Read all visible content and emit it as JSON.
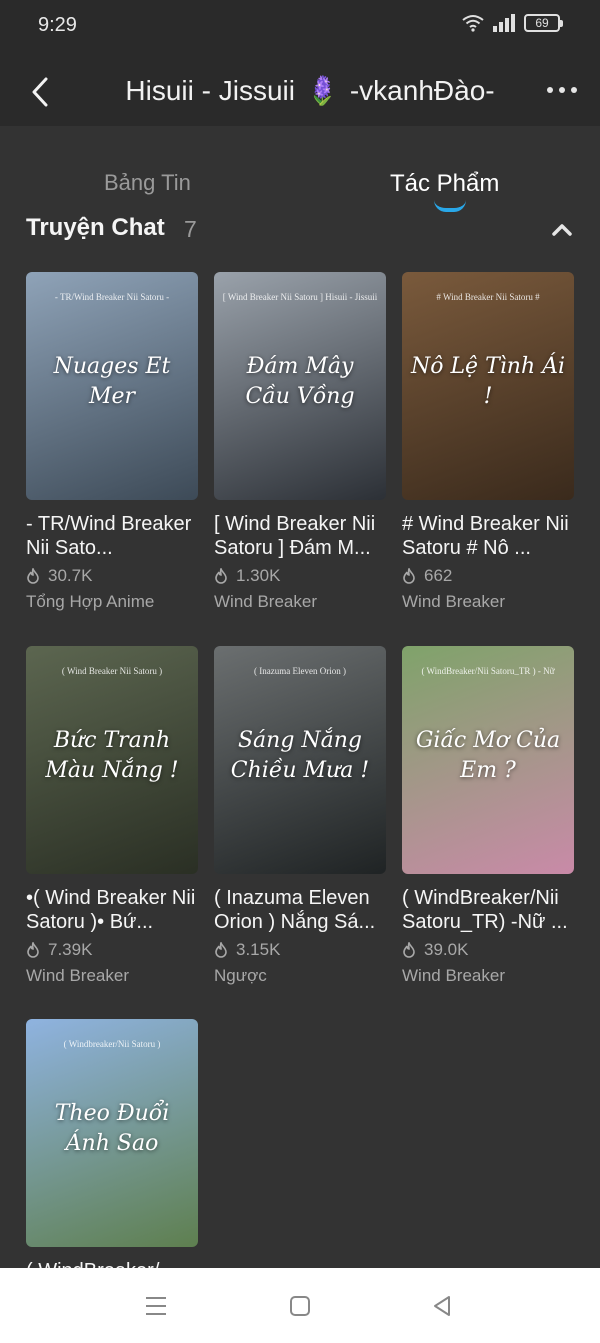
{
  "status": {
    "time": "9:29",
    "battery": "69"
  },
  "header": {
    "title": "Hisuii - Jissuii",
    "title_suffix": "-vkanhĐào-",
    "flower_emoji": "🪻"
  },
  "tabs": [
    {
      "label": "Bảng Tin"
    },
    {
      "label": "Tác Phẩm"
    }
  ],
  "section": {
    "title": "Truyện Chat",
    "count": "7"
  },
  "stories": [
    {
      "title": "- TR/Wind Breaker Nii Sato...",
      "reads": "30.7K",
      "genre": "Tổng Hợp Anime",
      "cover_tag": "- TR/Wind Breaker Nii Satoru -",
      "cover_text": "Nuages Et Mer",
      "cover_colors": [
        "#8fa3b8",
        "#3d4a57"
      ]
    },
    {
      "title": "[ Wind Breaker Nii Satoru ] Đám M...",
      "reads": "1.30K",
      "genre": "Wind Breaker",
      "cover_tag": "[ Wind Breaker Nii Satoru ] Hisuii - Jissuii",
      "cover_text": "Đám Mây Cầu Vồng",
      "cover_colors": [
        "#9aa2ab",
        "#2c3036"
      ]
    },
    {
      "title": "# Wind Breaker Nii Satoru # Nô ...",
      "reads": "662",
      "genre": "Wind Breaker",
      "cover_tag": "# Wind Breaker Nii Satoru #",
      "cover_text": "Nô Lệ Tình Ái !",
      "cover_colors": [
        "#7a5a3c",
        "#3a2a1c"
      ]
    },
    {
      "title": "•( Wind Breaker Nii Satoru )• Bứ...",
      "reads": "7.39K",
      "genre": "Wind Breaker",
      "cover_tag": "( Wind Breaker Nii Satoru )",
      "cover_text": "Bức Tranh Màu Nắng !",
      "cover_colors": [
        "#5c6650",
        "#2a2f24"
      ]
    },
    {
      "title": "( Inazuma Eleven Orion ) Nắng Sá...",
      "reads": "3.15K",
      "genre": "Ngược",
      "cover_tag": "( Inazuma Eleven Orion )",
      "cover_text": "Sáng Nắng Chiều Mưa !",
      "cover_colors": [
        "#6b6f70",
        "#1f2324"
      ]
    },
    {
      "title": "( WindBreaker/Nii Satoru_TR) -Nữ ...",
      "reads": "39.0K",
      "genre": "Wind Breaker",
      "cover_tag": "( WindBreaker/Nii Satoru_TR ) - Nữ",
      "cover_text": "Giấc Mơ Của Em ?",
      "cover_colors": [
        "#7fa36a",
        "#c98aa8"
      ]
    },
    {
      "title": "( WindBreaker/...",
      "reads": "",
      "genre": "",
      "cover_tag": "( Windbreaker/Nii Satoru )",
      "cover_text": "Theo Đuổi Ánh Sao",
      "cover_colors": [
        "#8fb3e0",
        "#5e7f4f"
      ]
    }
  ]
}
